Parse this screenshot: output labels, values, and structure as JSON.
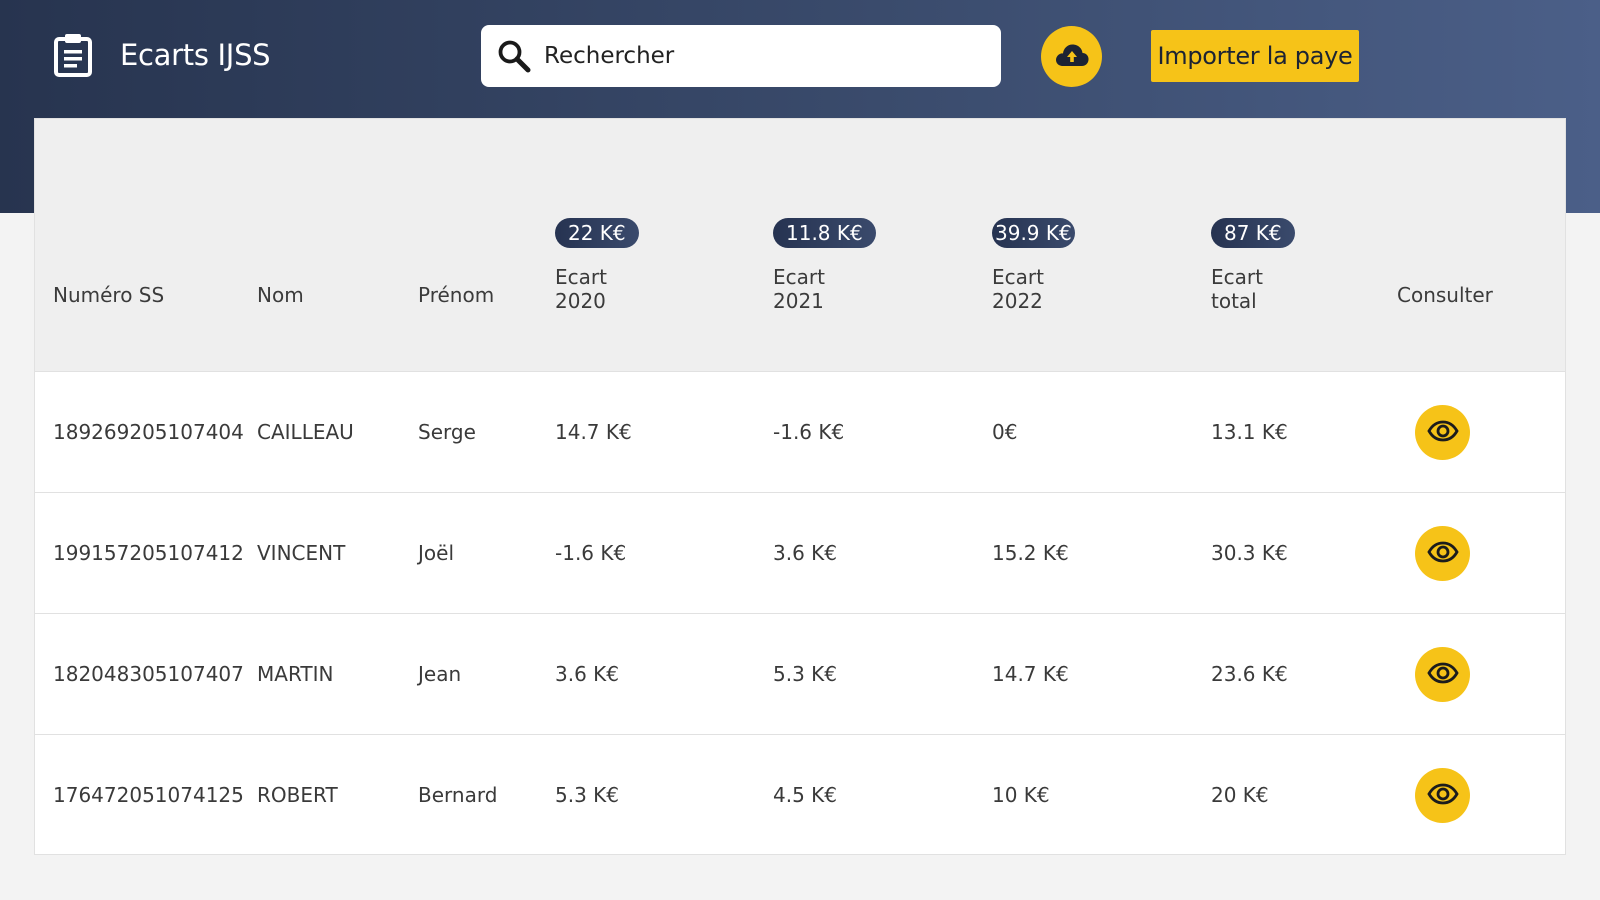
{
  "header": {
    "app_title": "Ecarts IJSS",
    "search": {
      "placeholder": "Rechercher",
      "value": ""
    },
    "import_label": "Importer la paye",
    "icons": {
      "brand": "clipboard-icon",
      "search": "search-icon",
      "upload": "cloud-upload-icon"
    }
  },
  "colors": {
    "accent": "#f6c318",
    "header_start": "#27344f",
    "header_end": "#4b5f88",
    "badge": "#263351"
  },
  "table": {
    "headers": {
      "numero_ss": "Numéro SS",
      "nom": "Nom",
      "prenom": "Prénom",
      "ecart2020": [
        "Ecart",
        "2020"
      ],
      "ecart2021": [
        "Ecart",
        "2021"
      ],
      "ecart2022": [
        "Ecart",
        "2022"
      ],
      "ecart_total": [
        "Ecart",
        "total"
      ],
      "consulter": "Consulter"
    },
    "totals": {
      "ecart2020": "22 K€",
      "ecart2021": "11.8 K€",
      "ecart2022": "39.9 K€",
      "ecart_total": "87 K€"
    },
    "rows": [
      {
        "numero_ss": "189269205107404",
        "nom": "CAILLEAU",
        "prenom": "Serge",
        "ecart2020": "14.7 K€",
        "ecart2021": "-1.6 K€",
        "ecart2022": "0€",
        "ecart_total": "13.1 K€"
      },
      {
        "numero_ss": "199157205107412",
        "nom": "VINCENT",
        "prenom": "Joël",
        "ecart2020": "-1.6 K€",
        "ecart2021": "3.6 K€",
        "ecart2022": "15.2 K€",
        "ecart_total": "30.3 K€"
      },
      {
        "numero_ss": "182048305107407",
        "nom": "MARTIN",
        "prenom": "Jean",
        "ecart2020": "3.6 K€",
        "ecart2021": "5.3 K€",
        "ecart2022": "14.7 K€",
        "ecart_total": "23.6 K€"
      },
      {
        "numero_ss": "176472051074125",
        "nom": "ROBERT",
        "prenom": "Bernard",
        "ecart2020": "5.3 K€",
        "ecart2021": "4.5 K€",
        "ecart2022": "10 K€",
        "ecart_total": "20 K€"
      }
    ],
    "view_icon": "eye-icon"
  }
}
